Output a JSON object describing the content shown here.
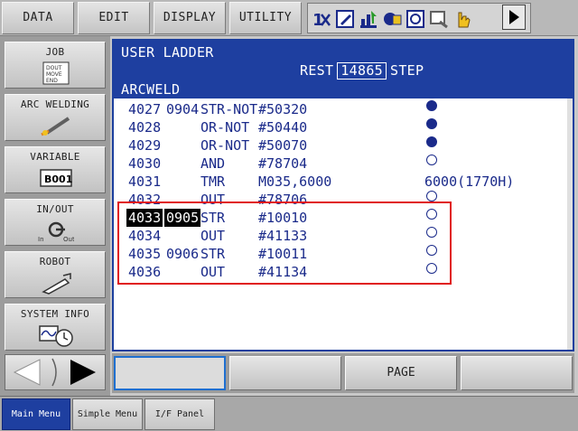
{
  "top_menu": {
    "data_label": "DATA",
    "edit_label": "EDIT",
    "display_label": "DISPLAY",
    "utility_label": "UTILITY"
  },
  "status_icons": [
    "group-axes-icon",
    "edit-mode-icon",
    "cycle-icon",
    "security-mode-icon",
    "coordinate-icon",
    "step-mode-icon",
    "hand-teach-icon",
    "play-arrow-icon"
  ],
  "side_menu": {
    "job_label": "JOB",
    "job_icon_text": "DOUT MOVE END",
    "arc_label": "ARC WELDING",
    "variable_label": "VARIABLE",
    "variable_icon_text": "B001",
    "inout_label": "IN/OUT",
    "inout_in": "In",
    "inout_out": "Out",
    "robot_label": "ROBOT",
    "system_label": "SYSTEM INFO"
  },
  "header": {
    "title": "USER LADDER",
    "rest_label": "REST",
    "rest_value": "14865",
    "step_label": "STEP",
    "job_name": "ARCWELD"
  },
  "ladder": [
    {
      "line": "4027",
      "step": "0904",
      "inst": "STR-NOT",
      "arg": "#50320",
      "extra": "",
      "dot": "on"
    },
    {
      "line": "4028",
      "step": "",
      "inst": "OR-NOT",
      "arg": "#50440",
      "extra": "",
      "dot": "on"
    },
    {
      "line": "4029",
      "step": "",
      "inst": "OR-NOT",
      "arg": "#50070",
      "extra": "",
      "dot": "on"
    },
    {
      "line": "4030",
      "step": "",
      "inst": "AND",
      "arg": "#78704",
      "extra": "",
      "dot": "off"
    },
    {
      "line": "4031",
      "step": "",
      "inst": "TMR",
      "arg": "M035,6000",
      "extra": "6000(1770H)",
      "dot": "none"
    },
    {
      "line": "4032",
      "step": "",
      "inst": "OUT",
      "arg": "#78706",
      "extra": "",
      "dot": "off"
    },
    {
      "line": "4033",
      "step": "0905",
      "inst": "STR",
      "arg": "#10010",
      "extra": "",
      "dot": "off",
      "cursor": true
    },
    {
      "line": "4034",
      "step": "",
      "inst": "OUT",
      "arg": "#41133",
      "extra": "",
      "dot": "off"
    },
    {
      "line": "4035",
      "step": "0906",
      "inst": "STR",
      "arg": "#10011",
      "extra": "",
      "dot": "off"
    },
    {
      "line": "4036",
      "step": "",
      "inst": "OUT",
      "arg": "#41134",
      "extra": "",
      "dot": "off"
    }
  ],
  "softkeys": {
    "key1": "",
    "key2": "",
    "key3": "PAGE",
    "key4": ""
  },
  "tabs": {
    "main_menu": "Main Menu",
    "simple_menu": "Simple Menu",
    "if_panel": "I/F Panel"
  },
  "colors": {
    "header_blue": "#1e3fa0",
    "list_text": "#1a2a8a",
    "highlight_red": "#e01818"
  }
}
